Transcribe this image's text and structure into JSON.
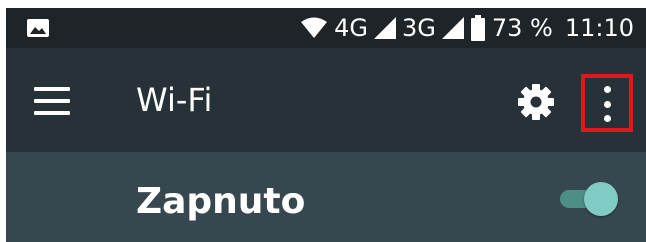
{
  "status_bar": {
    "network_4g": "4G",
    "network_3g": "3G",
    "battery_percent": "73 %",
    "time": "11:10",
    "icons": [
      "image-notification-icon",
      "wifi-signal-icon",
      "cell-signal-icon",
      "battery-icon"
    ]
  },
  "app_bar": {
    "title": "Wi-Fi",
    "icons": [
      "menu-icon",
      "settings-gear-icon",
      "more-vert-icon"
    ],
    "highlight_color": "#e0171f"
  },
  "master_switch": {
    "label": "Zapnuto",
    "state": "on",
    "accent": "#80cbc4"
  },
  "colors": {
    "status_bar_bg": "#1e2428",
    "app_bar_bg": "#263238",
    "content_bg": "#37474f"
  }
}
